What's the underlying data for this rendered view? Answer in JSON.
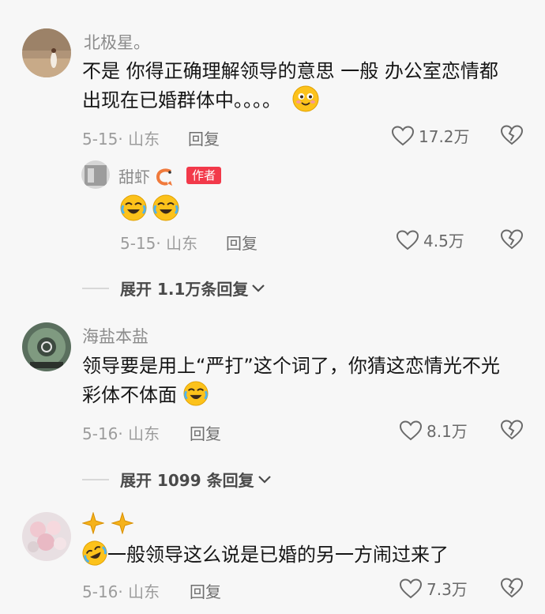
{
  "comments": [
    {
      "username": "北极星。",
      "text_line1": "不是 你得正确理解领导的意思 一般 办公室恋情都",
      "text_line2": "出现在已婚群体中。。。。",
      "date_location": "5-15· 山东",
      "reply_label": "回复",
      "like_count": "17.2万"
    },
    {
      "username": "甜虾",
      "author_badge": "作者",
      "date_location": "5-15· 山东",
      "reply_label": "回复",
      "like_count": "4.5万"
    },
    {
      "username": "海盐本盐",
      "text_line1": "领导要是用上“严打”这个词了，你猜这恋情光不光",
      "text_line2": "彩体不体面",
      "date_location": "5-16· 山东",
      "reply_label": "回复",
      "like_count": "8.1万"
    },
    {
      "text": "一般领导这么说是已婚的另一方闹过来了",
      "date_location": "5-16· 山东",
      "reply_label": "回复",
      "like_count": "7.3万"
    }
  ],
  "expand_replies": [
    {
      "label": "展开 1.1万条回复"
    },
    {
      "label": "展开 1099 条回复"
    }
  ],
  "colors": {
    "badge": "#f2394a",
    "background": "#f7f7f7"
  }
}
